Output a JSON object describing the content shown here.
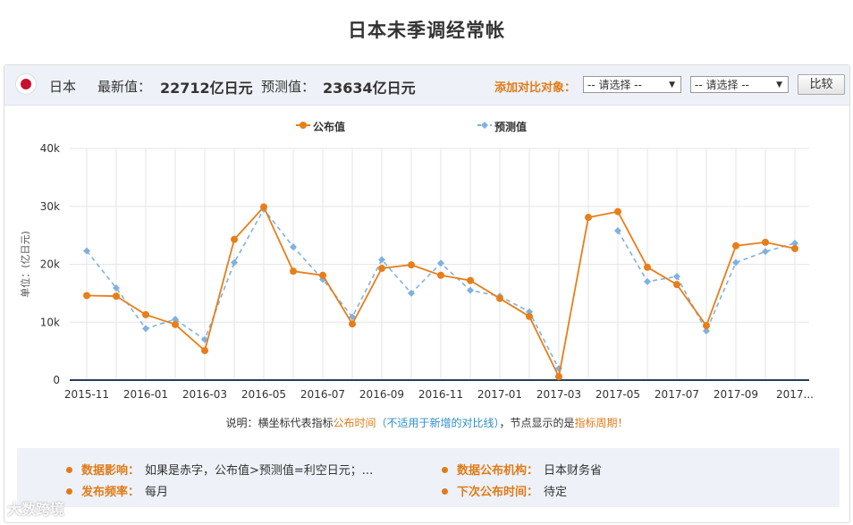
{
  "page": {
    "title": "日本未季调经常帐"
  },
  "header": {
    "country": "日本",
    "latest_label": "最新值：",
    "latest_value": "22712亿日元",
    "forecast_label": "预测值：",
    "forecast_value": "23634亿日元",
    "compare_label": "添加对比对象：",
    "select1": "-- 请选择 --",
    "select2": "-- 请选择 --",
    "compare_button": "比较",
    "flag_icon": "japan-flag-icon"
  },
  "legend": {
    "published": "公布值",
    "forecast": "预测值"
  },
  "colors": {
    "published": "#e87e1a",
    "forecast": "#7fb1e0",
    "accent": "#e07b18"
  },
  "chart_data": {
    "type": "line",
    "ylabel": "单位：(亿日元)",
    "ylim": [
      0,
      40000
    ],
    "yticks": [
      "0",
      "10k",
      "20k",
      "30k",
      "40k"
    ],
    "xtick_labels": [
      "2015-11",
      "2016-01",
      "2016-03",
      "2016-05",
      "2016-07",
      "2016-09",
      "2016-11",
      "2017-01",
      "2017-03",
      "2017-05",
      "2017-07",
      "2017-09",
      "2017..."
    ],
    "x": [
      "2015-11",
      "2015-12",
      "2016-01",
      "2016-02",
      "2016-03",
      "2016-04",
      "2016-05",
      "2016-06",
      "2016-07",
      "2016-08",
      "2016-09",
      "2016-10",
      "2016-11",
      "2016-12",
      "2017-01",
      "2017-02",
      "2017-03",
      "2017-04",
      "2017-05",
      "2017-06",
      "2017-07",
      "2017-08",
      "2017-09",
      "2017-10",
      "2017-11"
    ],
    "series": [
      {
        "name": "公布值",
        "values": [
          14600,
          14500,
          11300,
          9600,
          5100,
          24300,
          29900,
          18800,
          18100,
          9700,
          19300,
          19900,
          18100,
          17200,
          14100,
          11000,
          600,
          28100,
          29100,
          19500,
          16500,
          9400,
          23200,
          23800,
          22712
        ]
      },
      {
        "name": "预测值",
        "values": [
          22300,
          15900,
          8900,
          10500,
          7000,
          20300,
          29500,
          23000,
          17400,
          10900,
          20800,
          15000,
          20200,
          15500,
          14500,
          11800,
          2000,
          null,
          25800,
          17000,
          17900,
          8500,
          20300,
          22200,
          23634
        ]
      }
    ]
  },
  "note": {
    "prefix": "说明：横坐标代表指标",
    "time": "公布时间",
    "paren": "（不适用于新增的对比线）",
    "middle": "，节点显示的是",
    "period": "指标周期",
    "suffix": "！"
  },
  "info": {
    "impact_label": "数据影响：",
    "impact_value": "如果是赤字，公布值>预测值=利空日元；...",
    "org_label": "数据公布机构：",
    "org_value": "日本财务省",
    "freq_label": "发布频率：",
    "freq_value": "每月",
    "next_label": "下次公布时间：",
    "next_value": "待定"
  },
  "watermark": "大数跨境"
}
